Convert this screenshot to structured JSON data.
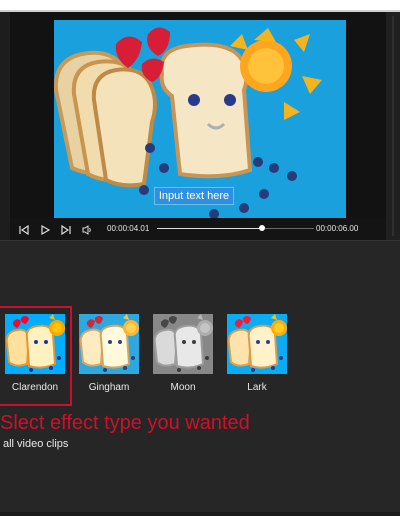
{
  "player": {
    "overlay_text": "Input text here",
    "current_time": "00:00:04.01",
    "total_time": "00:00:06.00",
    "progress": 0.67
  },
  "controls": {
    "icons": [
      "skip-start-icon",
      "play-icon",
      "skip-end-icon",
      "volume-icon"
    ]
  },
  "effects": {
    "items": [
      {
        "label": "Clarendon",
        "selected": true,
        "filter": "saturate(1.35) contrast(1.1)"
      },
      {
        "label": "Gingham",
        "selected": false,
        "filter": "saturate(0.85) brightness(1.08)"
      },
      {
        "label": "Moon",
        "selected": false,
        "filter": "grayscale(1)"
      },
      {
        "label": "Lark",
        "selected": false,
        "filter": "saturate(1.15) brightness(1.05)"
      }
    ]
  },
  "instruction": "Slect effect type you wanted",
  "apply_all_text": "all video clips",
  "colors": {
    "accent": "#c8102e",
    "background": "#262626",
    "video_bg": "#1aa0dc"
  }
}
